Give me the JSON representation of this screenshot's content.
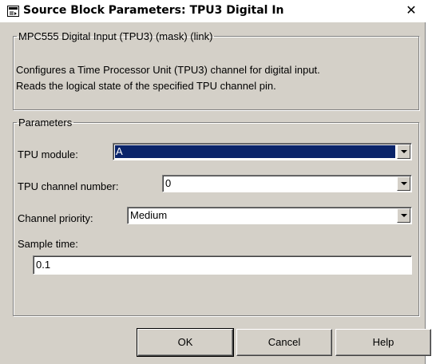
{
  "window": {
    "title": "Source Block Parameters: TPU3 Digital In",
    "close_glyph": "✕"
  },
  "description": {
    "group_title": "MPC555 Digital Input (TPU3) (mask) (link)",
    "line1": "Configures a Time Processor Unit (TPU3) channel for digital input.",
    "line2": "Reads the logical state of the specified TPU channel pin."
  },
  "parameters": {
    "group_title": "Parameters",
    "tpu_module": {
      "label": "TPU module:",
      "value": "A"
    },
    "tpu_channel": {
      "label": "TPU channel number:",
      "value": "0"
    },
    "channel_priority": {
      "label": "Channel priority:",
      "value": "Medium"
    },
    "sample_time": {
      "label": "Sample time:",
      "value": "0.1"
    }
  },
  "buttons": {
    "ok": "OK",
    "cancel": "Cancel",
    "help": "Help"
  }
}
